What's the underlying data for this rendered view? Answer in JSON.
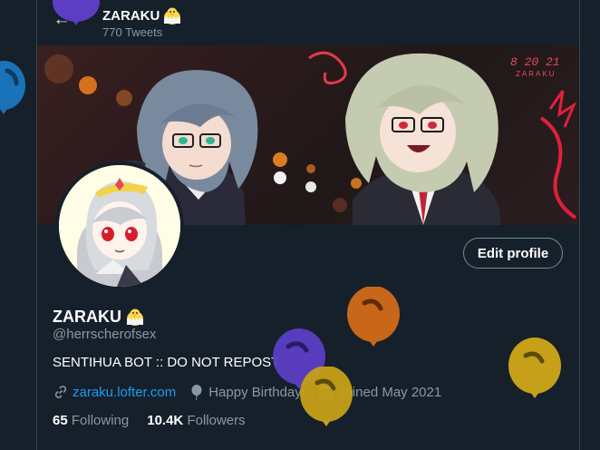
{
  "header": {
    "name": "ZARAKU",
    "tweet_count": "770 Tweets",
    "back_icon": "arrow-left-icon"
  },
  "banner": {
    "date_text": "8 20 21",
    "signature": "ZARAKU"
  },
  "profile": {
    "display_name": "ZARAKU",
    "handle": "@herrscherofsex",
    "bio": "SENTIHUA BOT :: DO NOT REPOST",
    "website": "zaraku.lofter.com",
    "birthday": "Happy Birthday!",
    "joined": "Joined May 2021",
    "following_count": "65",
    "following_label": "Following",
    "followers_count": "10.4K",
    "followers_label": "Followers",
    "edit_label": "Edit profile"
  },
  "colors": {
    "background": "#15202b",
    "link": "#1d9bf0",
    "muted": "#8899a6",
    "balloon_purple": "#5b3ec4",
    "balloon_blue": "#1a73b8",
    "balloon_orange": "#c8661a",
    "balloon_gold": "#c6a018"
  }
}
